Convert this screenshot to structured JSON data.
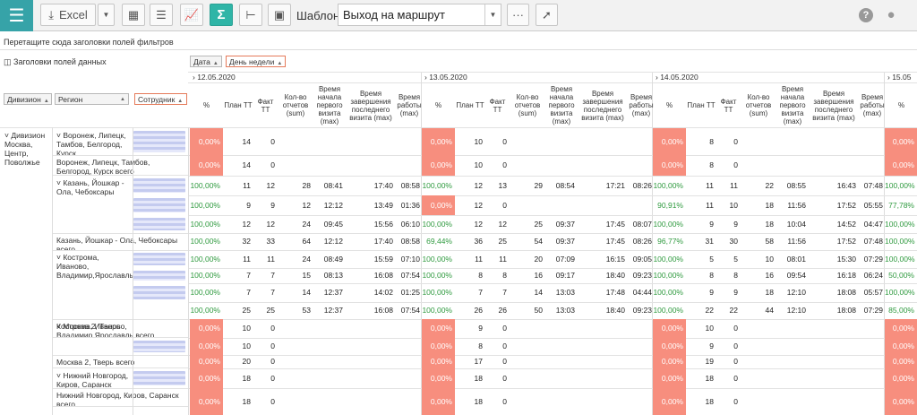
{
  "toolbar": {
    "excel": "Excel",
    "template_label": "Шаблон",
    "template_value": "Выход на маршрут"
  },
  "hint": "Перетащите сюда заголовки полей фильтров",
  "data_fields": "Заголовки полей данных",
  "col_fields": [
    "Дата",
    "День недели"
  ],
  "row_fields": [
    "Дивизион",
    "Регион",
    "Сотрудник"
  ],
  "dates": [
    "12.05.2020",
    "13.05.2020",
    "14.05.2020",
    "15.05"
  ],
  "col_headers": [
    "%",
    "План ТТ",
    "Факт ТТ",
    "Кол-во отчетов (sum)",
    "Время начала первого визита (max)",
    "Время завершения последнего визита (max)",
    "Время работы (max)"
  ],
  "division": "Дивизион Москва, Центр, Поволжье",
  "rows": [
    {
      "g": [
        "0,00%",
        "14",
        "0",
        "",
        "",
        "",
        ""
      ],
      "g2": [
        "0,00%",
        "10",
        "0",
        "",
        "",
        "",
        ""
      ],
      "g3": [
        "0,00%",
        "8",
        "0",
        "",
        "",
        "",
        ""
      ],
      "g4": "0,00%"
    },
    {
      "g": [
        "0,00%",
        "14",
        "0",
        "",
        "",
        "",
        ""
      ],
      "g2": [
        "0,00%",
        "10",
        "0",
        "",
        "",
        "",
        ""
      ],
      "g3": [
        "0,00%",
        "8",
        "0",
        "",
        "",
        "",
        ""
      ],
      "g4": "0,00%"
    },
    {
      "g": [
        "100,00%",
        "11",
        "12",
        "28",
        "08:41",
        "17:40",
        "08:58"
      ],
      "g2": [
        "100,00%",
        "12",
        "13",
        "29",
        "08:54",
        "17:21",
        "08:26"
      ],
      "g3": [
        "100,00%",
        "11",
        "11",
        "22",
        "08:55",
        "16:43",
        "07:48"
      ],
      "g4": "100,00%"
    },
    {
      "g": [
        "100,00%",
        "9",
        "9",
        "12",
        "12:12",
        "13:49",
        "01:36"
      ],
      "g2": [
        "0,00%",
        "12",
        "0",
        "",
        "",
        "",
        ""
      ],
      "g3": [
        "90,91%",
        "11",
        "10",
        "18",
        "11:56",
        "17:52",
        "05:55"
      ],
      "g4": "77,78%"
    },
    {
      "g": [
        "100,00%",
        "12",
        "12",
        "24",
        "09:45",
        "15:56",
        "06:10"
      ],
      "g2": [
        "100,00%",
        "12",
        "12",
        "25",
        "09:37",
        "17:45",
        "08:07"
      ],
      "g3": [
        "100,00%",
        "9",
        "9",
        "18",
        "10:04",
        "14:52",
        "04:47"
      ],
      "g4": "100,00%"
    },
    {
      "g": [
        "100,00%",
        "32",
        "33",
        "64",
        "12:12",
        "17:40",
        "08:58"
      ],
      "g2": [
        "69,44%",
        "36",
        "25",
        "54",
        "09:37",
        "17:45",
        "08:26"
      ],
      "g3": [
        "96,77%",
        "31",
        "30",
        "58",
        "11:56",
        "17:52",
        "07:48"
      ],
      "g4": "100,00%"
    },
    {
      "g": [
        "100,00%",
        "11",
        "11",
        "24",
        "08:49",
        "15:59",
        "07:10"
      ],
      "g2": [
        "100,00%",
        "11",
        "11",
        "20",
        "07:09",
        "16:15",
        "09:05"
      ],
      "g3": [
        "100,00%",
        "5",
        "5",
        "10",
        "08:01",
        "15:30",
        "07:29"
      ],
      "g4": "100,00%"
    },
    {
      "g": [
        "100,00%",
        "7",
        "7",
        "15",
        "08:13",
        "16:08",
        "07:54"
      ],
      "g2": [
        "100,00%",
        "8",
        "8",
        "16",
        "09:17",
        "18:40",
        "09:23"
      ],
      "g3": [
        "100,00%",
        "8",
        "8",
        "16",
        "09:54",
        "16:18",
        "06:24"
      ],
      "g4": "50,00%"
    },
    {
      "g": [
        "100,00%",
        "7",
        "7",
        "14",
        "12:37",
        "14:02",
        "01:25"
      ],
      "g2": [
        "100,00%",
        "7",
        "7",
        "14",
        "13:03",
        "17:48",
        "04:44"
      ],
      "g3": [
        "100,00%",
        "9",
        "9",
        "18",
        "12:10",
        "18:08",
        "05:57"
      ],
      "g4": "100,00%"
    },
    {
      "g": [
        "100,00%",
        "25",
        "25",
        "53",
        "12:37",
        "16:08",
        "07:54"
      ],
      "g2": [
        "100,00%",
        "26",
        "26",
        "50",
        "13:03",
        "18:40",
        "09:23"
      ],
      "g3": [
        "100,00%",
        "22",
        "22",
        "44",
        "12:10",
        "18:08",
        "07:29"
      ],
      "g4": "85,00%"
    },
    {
      "g": [
        "0,00%",
        "10",
        "0",
        "",
        "",
        "",
        ""
      ],
      "g2": [
        "0,00%",
        "9",
        "0",
        "",
        "",
        "",
        ""
      ],
      "g3": [
        "0,00%",
        "10",
        "0",
        "",
        "",
        "",
        ""
      ],
      "g4": "0,00%"
    },
    {
      "g": [
        "0,00%",
        "10",
        "0",
        "",
        "",
        "",
        ""
      ],
      "g2": [
        "0,00%",
        "8",
        "0",
        "",
        "",
        "",
        ""
      ],
      "g3": [
        "0,00%",
        "9",
        "0",
        "",
        "",
        "",
        ""
      ],
      "g4": "0,00%"
    },
    {
      "g": [
        "0,00%",
        "20",
        "0",
        "",
        "",
        "",
        ""
      ],
      "g2": [
        "0,00%",
        "17",
        "0",
        "",
        "",
        "",
        ""
      ],
      "g3": [
        "0,00%",
        "19",
        "0",
        "",
        "",
        "",
        ""
      ],
      "g4": "0,00%"
    },
    {
      "g": [
        "0,00%",
        "18",
        "0",
        "",
        "",
        "",
        ""
      ],
      "g2": [
        "0,00%",
        "18",
        "0",
        "",
        "",
        "",
        ""
      ],
      "g3": [
        "0,00%",
        "18",
        "0",
        "",
        "",
        "",
        ""
      ],
      "g4": "0,00%"
    },
    {
      "g": [
        "0,00%",
        "18",
        "0",
        "",
        "",
        "",
        ""
      ],
      "g2": [
        "0,00%",
        "18",
        "0",
        "",
        "",
        "",
        ""
      ],
      "g3": [
        "0,00%",
        "18",
        "0",
        "",
        "",
        "",
        ""
      ],
      "g4": "0,00%"
    }
  ],
  "regions": [
    {
      "name": "Воронеж, Липецк, Тамбов, Белгород, Курск",
      "total": "Воронеж, Липецк, Тамбов, Белгород, Курск всего"
    },
    {
      "name": "Казань, Йошкар - Ола, Чебоксары",
      "total": "Казань, Йошкар - Ола, Чебоксары всего"
    },
    {
      "name": "Кострома, Иваново, Владимир,Ярославль",
      "total": "Кострома, Иваново, Владимир,Ярославль всего"
    },
    {
      "name": "Москва 2, Тверь",
      "total": "Москва 2, Тверь всего"
    },
    {
      "name": "Нижний Новгород, Киров, Саранск",
      "total": "Нижний Новгород, Киров, Саранск всего"
    }
  ]
}
